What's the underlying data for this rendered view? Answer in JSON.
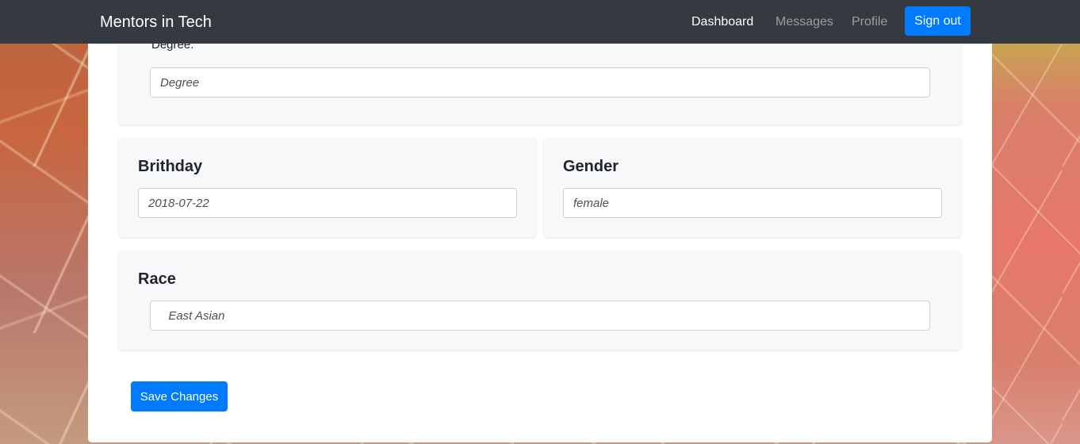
{
  "navbar": {
    "brand": "Mentors in Tech",
    "links": [
      {
        "label": "Dashboard",
        "active": true
      },
      {
        "label": "Messages",
        "active": false
      },
      {
        "label": "Profile",
        "active": false
      }
    ],
    "signout_label": "Sign out"
  },
  "form": {
    "degree": {
      "label": "Degree:",
      "placeholder": "Degree",
      "value": ""
    },
    "birthday": {
      "label": "Brithday",
      "value": "2018-07-22"
    },
    "gender": {
      "label": "Gender",
      "value": "female"
    },
    "race": {
      "label": "Race",
      "value": "  East Asian"
    },
    "save_label": "Save Changes"
  },
  "colors": {
    "navbar": "#343a40",
    "primary": "#007bff",
    "card": "#f7f8fa"
  }
}
